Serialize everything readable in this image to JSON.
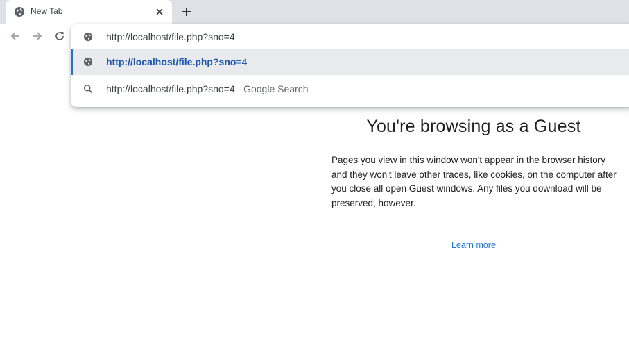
{
  "tab": {
    "title": "New Tab"
  },
  "omnibox": {
    "input_value": "http://localhost/file.php?sno=4",
    "suggestions": [
      {
        "icon": "globe-icon",
        "bold_part": "http://localhost/file.php?sno",
        "rest": "=4"
      },
      {
        "icon": "search-icon",
        "query": "http://localhost/file.php?sno=4",
        "separator": " - ",
        "engine": "Google Search"
      }
    ]
  },
  "guest": {
    "title": "You're browsing as a Guest",
    "description": "Pages you view in this window won't appear in the browser history and they won't leave other traces, like cookies, on the computer after you close all open Guest windows. Any files you download will be preserved, however.",
    "learn_more": "Learn more"
  },
  "colors": {
    "accent": "#1a73e8",
    "tabstrip": "#dee1e6",
    "selected_row": "#e8eaed"
  }
}
